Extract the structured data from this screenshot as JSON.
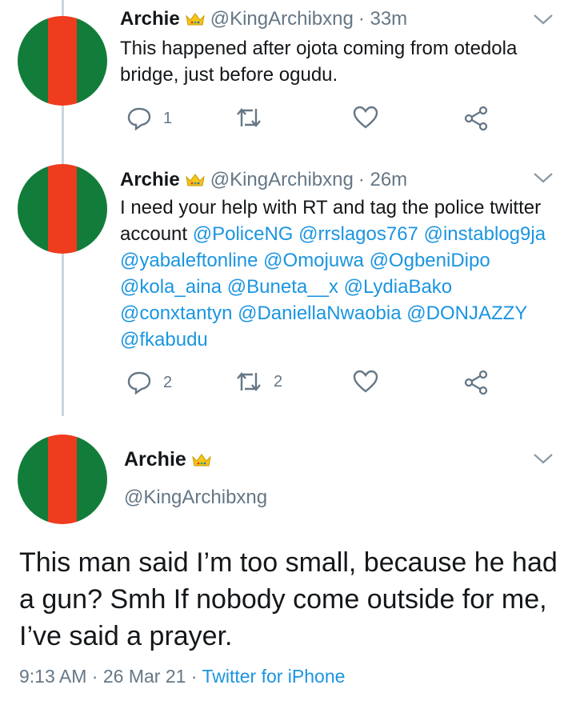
{
  "tweets": [
    {
      "name": "Archie",
      "handle": "@KingArchibxng",
      "time": "· 33m",
      "text": "This happened after ojota coming from otedola bridge, just before ogudu.",
      "replies": "1",
      "retweets": "",
      "icons": [
        "reply-icon",
        "retweet-icon",
        "like-icon",
        "share-icon"
      ]
    },
    {
      "name": "Archie",
      "handle": "@KingArchibxng",
      "time": "· 26m",
      "text": "I need your help with RT and tag the police twitter account",
      "mentions": [
        "@PoliceNG",
        "@rrslagos767",
        "@instablog9ja",
        "@yabaleftonline",
        "@Omojuwa",
        "@OgbeniDipo",
        "@kola_aina",
        "@Buneta__x",
        "@LydiaBako",
        "@conxtantyn",
        "@DaniellaNwaobia",
        "@DONJAZZY",
        "@fkabudu"
      ],
      "replies": "2",
      "retweets": "2"
    }
  ],
  "main_tweet": {
    "name": "Archie",
    "handle": "@KingArchibxng",
    "text": "This man said I’m too small, because he had a gun? Smh If nobody come outside for me, I’ve said a prayer.",
    "time": "9:13 AM",
    "date": "26 Mar 21",
    "source": "Twitter for iPhone",
    "sep": "·"
  },
  "colors": {
    "accent": "#1b95e0",
    "muted": "#657786",
    "avatar_green": "#127d3a",
    "avatar_red": "#ef3b1e",
    "crown": "#f5c518"
  }
}
